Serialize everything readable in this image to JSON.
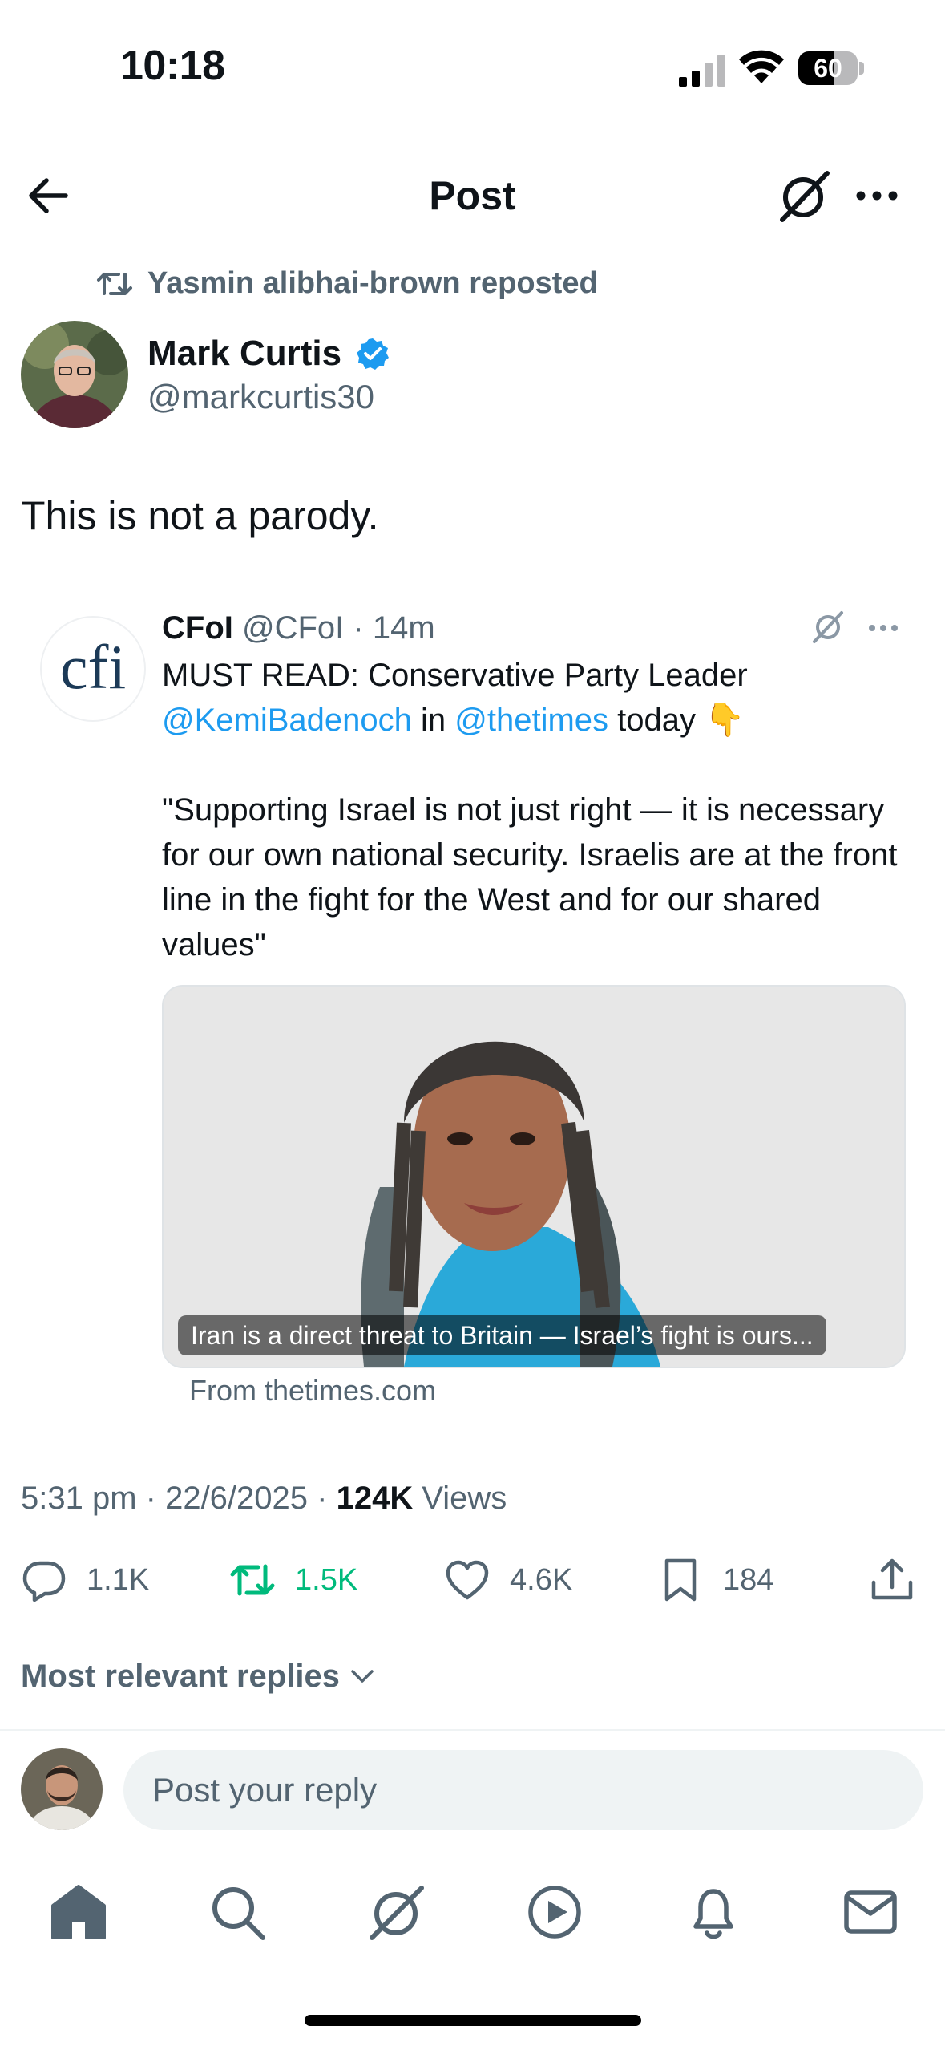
{
  "status_bar": {
    "time": "10:18",
    "battery": "60",
    "battery_level": 0.6
  },
  "header": {
    "title": "Post"
  },
  "repost_banner": {
    "text": "Yasmin alibhai-brown reposted"
  },
  "post": {
    "author_name": "Mark Curtis",
    "author_handle": "@markcurtis30",
    "text": "This is not a parody.",
    "timestamp": "5:31 pm · 22/6/2025 · ",
    "views_count": "124K",
    "views_label": " Views"
  },
  "quoted": {
    "name": "CFoI",
    "meta": " @CFoI · 14m",
    "line1": "MUST READ: Conservative Party Leader",
    "mention1": "@KemiBadenoch",
    "in_word": " in ",
    "mention2": "@thetimes",
    "today": " today 👇",
    "quote": "\"Supporting Israel is not just right — it is necessary for our own national security. Israelis are at the front line in the fight for the West and for our shared values\"",
    "avatar_text": "cfi",
    "card_caption": "Iran is a direct threat to Britain — Israel’s fight is ours...",
    "card_source": "From thetimes.com"
  },
  "actions": {
    "replies": "1.1K",
    "reposts": "1.5K",
    "likes": "4.6K",
    "bookmarks": "184"
  },
  "replies_sort": {
    "label": "Most relevant replies"
  },
  "reply_box": {
    "placeholder": "Post your reply"
  },
  "colors": {
    "accent": "#1d9bf0",
    "repost_green": "#00ba7c",
    "secondary_text": "#536471"
  },
  "icons": [
    "back-arrow-icon",
    "grok-icon",
    "more-icon",
    "repost-icon",
    "verified-badge-icon",
    "reply-icon",
    "like-icon",
    "bookmark-icon",
    "share-icon",
    "chevron-down-icon",
    "home-icon",
    "search-icon",
    "video-icon",
    "notifications-icon",
    "messages-icon"
  ]
}
